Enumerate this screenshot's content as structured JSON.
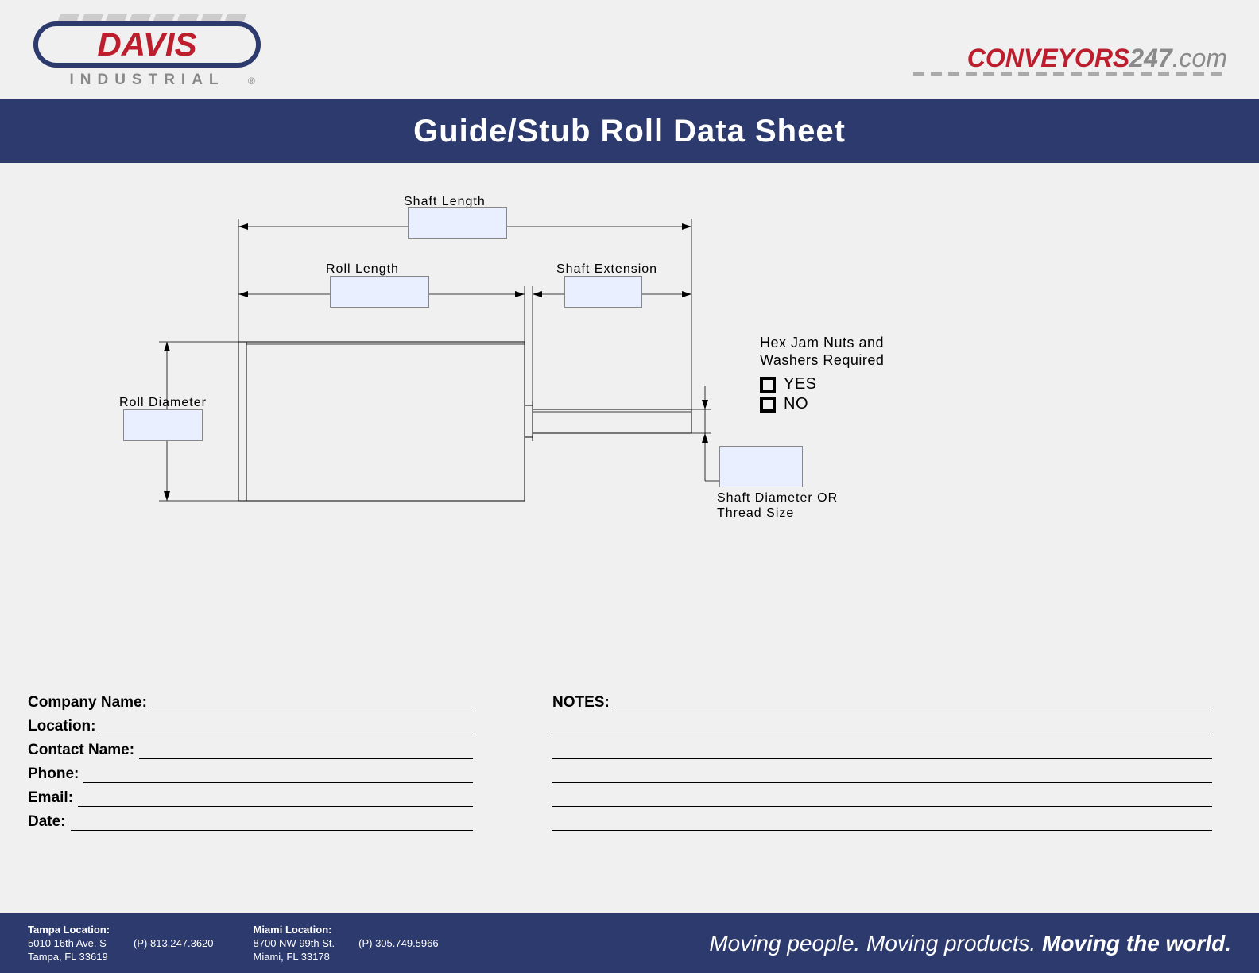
{
  "header": {
    "logo_primary_text": "DAVIS",
    "logo_secondary_text": "INDUSTRIAL",
    "logo_trademark": "®",
    "conveyors_red": "CONVEYORS",
    "conveyors_num": "247",
    "conveyors_tld": ".com"
  },
  "title": "Guide/Stub Roll Data Sheet",
  "diagram": {
    "shaft_length_label": "Shaft Length",
    "roll_length_label": "Roll Length",
    "shaft_extension_label": "Shaft Extension",
    "roll_diameter_label": "Roll Diameter",
    "shaft_diameter_label_1": "Shaft Diameter OR",
    "shaft_diameter_label_2": "Thread Size",
    "hex_label_line1": "Hex Jam Nuts and",
    "hex_label_line2": "Washers Required",
    "yes": "YES",
    "no": "NO"
  },
  "form": {
    "company_name": "Company Name:",
    "location": "Location:",
    "contact_name": "Contact Name:",
    "phone": "Phone:",
    "email": "Email:",
    "date": "Date:",
    "notes": "NOTES:"
  },
  "footer": {
    "tampa_title": "Tampa Location:",
    "tampa_addr1": "5010 16th Ave. S",
    "tampa_addr2": "Tampa, FL 33619",
    "tampa_phone": "(P) 813.247.3620",
    "miami_title": "Miami Location:",
    "miami_addr1": "8700 NW 99th St.",
    "miami_addr2": "Miami, FL 33178",
    "miami_phone": "(P) 305.749.5966",
    "tagline_1": "Moving people. ",
    "tagline_2": "Moving products. ",
    "tagline_3": "Moving the world."
  }
}
